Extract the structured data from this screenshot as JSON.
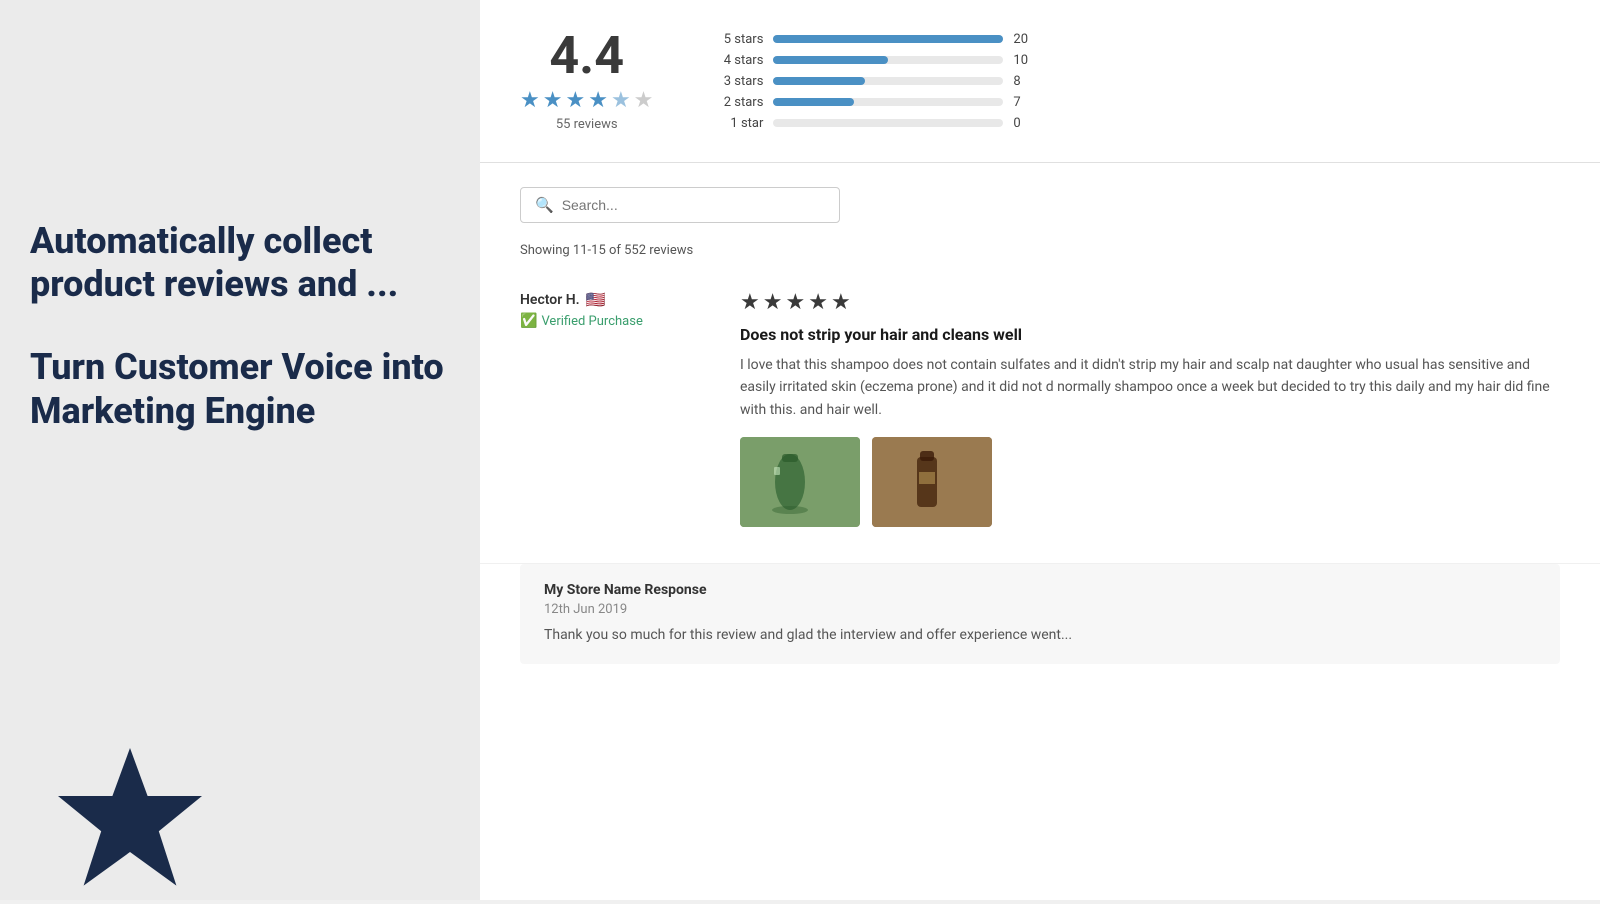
{
  "left": {
    "heading1": "Automatically collect\nproduct reviews and ...",
    "heading2": "Turn Customer Voice into\nMarketing Engine"
  },
  "ratings": {
    "overall": "4.4",
    "review_count": "55 reviews",
    "bars": [
      {
        "label": "5 stars",
        "count": 20,
        "max": 20,
        "percent": 100
      },
      {
        "label": "4 stars",
        "count": 10,
        "max": 20,
        "percent": 50
      },
      {
        "label": "3 stars",
        "count": 8,
        "max": 20,
        "percent": 40
      },
      {
        "label": "2 stars",
        "count": 7,
        "max": 20,
        "percent": 35
      },
      {
        "label": "1 star",
        "count": 0,
        "max": 20,
        "percent": 0
      }
    ]
  },
  "search": {
    "placeholder": "Search...",
    "showing_text": "Showing 11-15 of 552 reviews"
  },
  "reviews": [
    {
      "reviewer": "Hector H.",
      "flag": "🇺🇸",
      "verified": "Verified Purchase",
      "stars": 5,
      "title": "Does not strip your hair and cleans well",
      "body": "I love that this shampoo does not contain sulfates and it didn't strip my hair and scalp nat daughter who usual has sensitive and easily irritated skin (eczema prone) and it did not d normally shampoo once a week but decided to try this daily and my hair did fine with this. and hair well.",
      "has_images": true
    }
  ],
  "store_response": {
    "title": "My Store Name Response",
    "date": "12th Jun 2019",
    "body": "Thank you so much for this review and glad the interview and offer experience went..."
  }
}
